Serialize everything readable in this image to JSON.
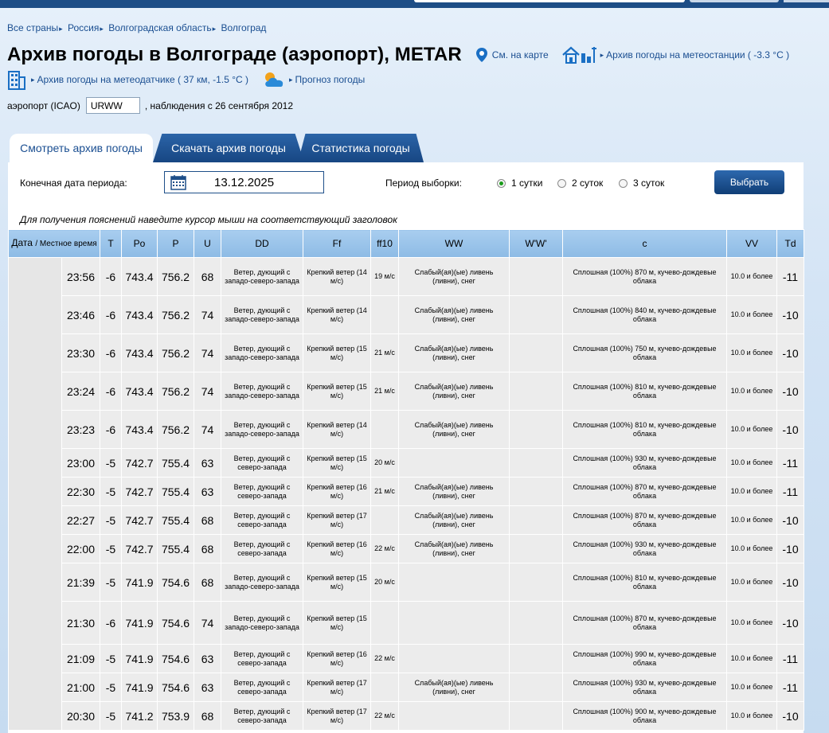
{
  "breadcrumb": [
    {
      "label": "Все страны"
    },
    {
      "label": "Россия"
    },
    {
      "label": "Волгоградская область"
    },
    {
      "label": "Волгоград"
    }
  ],
  "header": {
    "title": "Архив погоды в Волгограде (аэропорт), METAR",
    "map_link": "См. на карте",
    "station_link": "Архив погоды на метеостанции ( -3.3 °C )",
    "sensor_link": "Архив погоды на метеодатчике ( 37 км, -1.5 °C )",
    "forecast_link": "Прогноз погоды"
  },
  "icao": {
    "label": "аэропорт (ICAO)",
    "value": "URWW",
    "since": ", наблюдения с 26 сентября 2012"
  },
  "tabs": [
    {
      "label": "Смотреть архив погоды",
      "active": true
    },
    {
      "label": "Скачать архив погоды",
      "active": false
    },
    {
      "label": "Статистика погоды",
      "active": false
    }
  ],
  "controls": {
    "end_date_label": "Конечная дата периода:",
    "end_date": "13.12.2025",
    "period_label": "Период выборки:",
    "periods": [
      {
        "label": "1 сутки",
        "selected": true
      },
      {
        "label": "2 суток",
        "selected": false
      },
      {
        "label": "3 суток",
        "selected": false
      }
    ],
    "select_button": "Выбрать"
  },
  "hint": "Для получения пояснений наведите курсор мыши на соответствующий заголовок",
  "table": {
    "headers": {
      "date": "Дата",
      "local_time": "/ Местное время",
      "T": "T",
      "Po": "Po",
      "P": "P",
      "U": "U",
      "DD": "DD",
      "Ff": "Ff",
      "ff10": "ff10",
      "WW": "WW",
      "WW2": "W'W'",
      "c": "c",
      "VV": "VV",
      "Td": "Td"
    },
    "rows": [
      {
        "time": "23:56",
        "T": "-6",
        "Po": "743.4",
        "P": "756.2",
        "U": "68",
        "DD": "Ветер, дующий с западо-северо-запада",
        "Ff": "Крепкий ветер (14 м/с)",
        "ff10": "19 м/с",
        "WW": "Слабый(ая)(ые) ливень (ливни), снег",
        "WW2": "",
        "c": "Сплошная (100%) 870 м, кучево-дождевые облака",
        "VV": "10.0 и более",
        "Td": "-11"
      },
      {
        "time": "23:46",
        "T": "-6",
        "Po": "743.4",
        "P": "756.2",
        "U": "74",
        "DD": "Ветер, дующий с западо-северо-запада",
        "Ff": "Крепкий ветер (14 м/с)",
        "ff10": "",
        "WW": "Слабый(ая)(ые) ливень (ливни), снег",
        "WW2": "",
        "c": "Сплошная (100%) 840 м, кучево-дождевые облака",
        "VV": "10.0 и более",
        "Td": "-10"
      },
      {
        "time": "23:30",
        "T": "-6",
        "Po": "743.4",
        "P": "756.2",
        "U": "74",
        "DD": "Ветер, дующий с западо-северо-запада",
        "Ff": "Крепкий ветер (15 м/с)",
        "ff10": "21 м/с",
        "WW": "Слабый(ая)(ые) ливень (ливни), снег",
        "WW2": "",
        "c": "Сплошная (100%) 750 м, кучево-дождевые облака",
        "VV": "10.0 и более",
        "Td": "-10"
      },
      {
        "time": "23:24",
        "T": "-6",
        "Po": "743.4",
        "P": "756.2",
        "U": "74",
        "DD": "Ветер, дующий с западо-северо-запада",
        "Ff": "Крепкий ветер (15 м/с)",
        "ff10": "21 м/с",
        "WW": "Слабый(ая)(ые) ливень (ливни), снег",
        "WW2": "",
        "c": "Сплошная (100%) 810 м, кучево-дождевые облака",
        "VV": "10.0 и более",
        "Td": "-10"
      },
      {
        "time": "23:23",
        "T": "-6",
        "Po": "743.4",
        "P": "756.2",
        "U": "74",
        "DD": "Ветер, дующий с западо-северо-запада",
        "Ff": "Крепкий ветер (14 м/с)",
        "ff10": "",
        "WW": "Слабый(ая)(ые) ливень (ливни), снег",
        "WW2": "",
        "c": "Сплошная (100%) 810 м, кучево-дождевые облака",
        "VV": "10.0 и более",
        "Td": "-10"
      },
      {
        "time": "23:00",
        "T": "-5",
        "Po": "742.7",
        "P": "755.4",
        "U": "63",
        "DD": "Ветер, дующий с северо-запада",
        "Ff": "Крепкий ветер (15 м/с)",
        "ff10": "20 м/с",
        "WW": "",
        "WW2": "",
        "c": "Сплошная (100%) 930 м, кучево-дождевые облака",
        "VV": "10.0 и более",
        "Td": "-11"
      },
      {
        "time": "22:30",
        "T": "-5",
        "Po": "742.7",
        "P": "755.4",
        "U": "63",
        "DD": "Ветер, дующий с северо-запада",
        "Ff": "Крепкий ветер (16 м/с)",
        "ff10": "21 м/с",
        "WW": "Слабый(ая)(ые) ливень (ливни), снег",
        "WW2": "",
        "c": "Сплошная (100%) 870 м, кучево-дождевые облака",
        "VV": "10.0 и более",
        "Td": "-11"
      },
      {
        "time": "22:27",
        "T": "-5",
        "Po": "742.7",
        "P": "755.4",
        "U": "68",
        "DD": "Ветер, дующий с северо-запада",
        "Ff": "Крепкий ветер (17 м/с)",
        "ff10": "",
        "WW": "Слабый(ая)(ые) ливень (ливни), снег",
        "WW2": "",
        "c": "Сплошная (100%) 870 м, кучево-дождевые облака",
        "VV": "10.0 и более",
        "Td": "-10"
      },
      {
        "time": "22:00",
        "T": "-5",
        "Po": "742.7",
        "P": "755.4",
        "U": "68",
        "DD": "Ветер, дующий с северо-запада",
        "Ff": "Крепкий ветер (16 м/с)",
        "ff10": "22 м/с",
        "WW": "Слабый(ая)(ые) ливень (ливни), снег",
        "WW2": "",
        "c": "Сплошная (100%) 930 м, кучево-дождевые облака",
        "VV": "10.0 и более",
        "Td": "-10"
      },
      {
        "time": "21:39",
        "T": "-5",
        "Po": "741.9",
        "P": "754.6",
        "U": "68",
        "DD": "Ветер, дующий с западо-северо-запада",
        "Ff": "Крепкий ветер (15 м/с)",
        "ff10": "20 м/с",
        "WW": "",
        "WW2": "",
        "c": "Сплошная (100%) 810 м, кучево-дождевые облака",
        "VV": "10.0 и более",
        "Td": "-10"
      },
      {
        "time": "21:30",
        "T": "-6",
        "Po": "741.9",
        "P": "754.6",
        "U": "74",
        "DD": "Ветер, дующий с западо-северо-запада",
        "Ff": "Крепкий ветер (15 м/с)",
        "ff10": "",
        "WW": "",
        "WW2": "",
        "c": "Сплошная (100%) 870 м, кучево-дождевые облака",
        "VV": "10.0 и более",
        "Td": "-10"
      },
      {
        "time": "21:09",
        "T": "-5",
        "Po": "741.9",
        "P": "754.6",
        "U": "63",
        "DD": "Ветер, дующий с северо-запада",
        "Ff": "Крепкий ветер (16 м/с)",
        "ff10": "22 м/с",
        "WW": "",
        "WW2": "",
        "c": "Сплошная (100%) 990 м, кучево-дождевые облака",
        "VV": "10.0 и более",
        "Td": "-11"
      },
      {
        "time": "21:00",
        "T": "-5",
        "Po": "741.9",
        "P": "754.6",
        "U": "63",
        "DD": "Ветер, дующий с северо-запада",
        "Ff": "Крепкий ветер (17 м/с)",
        "ff10": "",
        "WW": "Слабый(ая)(ые) ливень (ливни), снег",
        "WW2": "",
        "c": "Сплошная (100%) 930 м, кучево-дождевые облака",
        "VV": "10.0 и более",
        "Td": "-11"
      },
      {
        "time": "20:30",
        "T": "-5",
        "Po": "741.2",
        "P": "753.9",
        "U": "68",
        "DD": "Ветер, дующий с северо-запада",
        "Ff": "Крепкий ветер (17 м/с)",
        "ff10": "22 м/с",
        "WW": "",
        "WW2": "",
        "c": "Сплошная (100%) 900 м, кучево-дождевые облака",
        "VV": "10.0 и более",
        "Td": "-10"
      }
    ]
  },
  "colors": {
    "link": "#1a4e91",
    "tab_blue": "#1d4f8c",
    "header_cell": "#9cc6ec",
    "row_cell": "#ececec",
    "radio_on": "#1a9b1a"
  }
}
